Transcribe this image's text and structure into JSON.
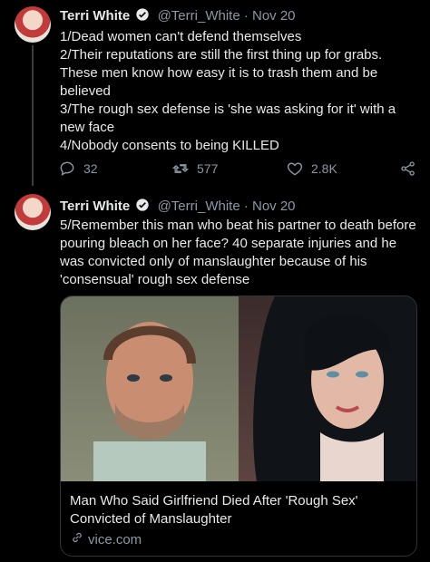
{
  "tweets": [
    {
      "name": "Terri White",
      "handle": "@Terri_White",
      "date": "· Nov 20",
      "text": "1/Dead women can't defend themselves\n2/Their reputations are still the first thing up for grabs. These men know how easy it is to trash them and be believed\n3/The rough sex defense is 'she was asking for it' with a new face\n4/Nobody consents to being KILLED",
      "replies": "32",
      "retweets": "577",
      "likes": "2.8K"
    },
    {
      "name": "Terri White",
      "handle": "@Terri_White",
      "date": "· Nov 20",
      "text": "5/Remember this man who beat his partner to death before pouring bleach on her face? 40 separate injuries and he was convicted only of manslaughter because of his 'consensual' rough sex defense",
      "card": {
        "title": "Man Who Said Girlfriend Died After 'Rough Sex' Convicted of Manslaughter",
        "domain": "vice.com"
      }
    }
  ],
  "colors": {
    "background": "#000000",
    "text": "#e7e9ea",
    "muted": "#8b98a5",
    "verified": "#1d9bf0"
  }
}
